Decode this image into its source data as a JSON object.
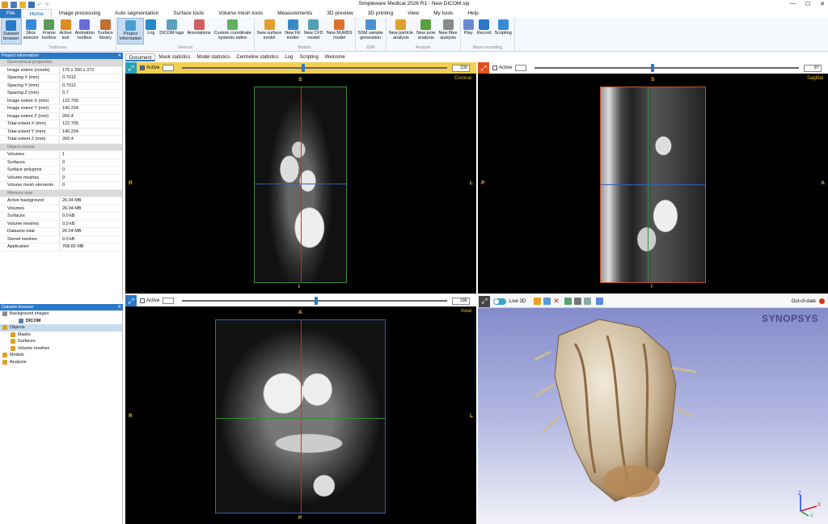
{
  "window": {
    "title": "Simpleware Medical 2026 R1 - New DICOM.sip",
    "minimize": "—",
    "maximize": "☐",
    "close": "✕"
  },
  "menu": [
    "File",
    "Home",
    "Image processing",
    "Auto segmentation",
    "Surface tools",
    "Volume mesh tools",
    "Measurements",
    "3D preview",
    "3D printing",
    "View",
    "My tools",
    "Help"
  ],
  "ribbon": {
    "groups": [
      {
        "label": "Toolboxes",
        "buttons": [
          [
            "Dataset",
            "browser"
          ],
          [
            "Slice",
            "selector"
          ],
          [
            "Frame",
            "toolbox"
          ],
          [
            "Active",
            "tool"
          ],
          [
            "Animation",
            "toolbox"
          ],
          [
            "Surface",
            "library"
          ]
        ]
      },
      {
        "label": "General",
        "buttons": [
          [
            "Project",
            "information"
          ],
          [
            "Log",
            ""
          ],
          [
            "DICOM tags",
            ""
          ],
          [
            "Annotations",
            ""
          ],
          [
            "Custom coordinate",
            "systems editor"
          ]
        ]
      },
      {
        "label": "Models",
        "buttons": [
          [
            "New surface",
            "model"
          ],
          [
            "New FE",
            "model"
          ],
          [
            "New CFD",
            "model"
          ],
          [
            "New NURBS",
            "model"
          ]
        ]
      },
      {
        "label": "SSM",
        "buttons": [
          [
            "SSM sample",
            "generation"
          ]
        ]
      },
      {
        "label": "Analysis",
        "buttons": [
          [
            "New particle",
            "analysis"
          ],
          [
            "New pore",
            "analysis"
          ],
          [
            "New fibre",
            "analysis"
          ]
        ]
      },
      {
        "label": "Macro recording",
        "buttons": [
          [
            "Play",
            ""
          ],
          [
            "Record",
            ""
          ],
          [
            "Scripting",
            ""
          ]
        ]
      }
    ]
  },
  "project_info": {
    "title": "Project information",
    "close": "✕",
    "rows": [
      {
        "k": "Geometrical properties",
        "v": "",
        "section": true
      },
      {
        "k": "Image extent (voxels)",
        "v": "175 x 200 x 372"
      },
      {
        "k": "Spacing X (mm)",
        "v": "0.7012"
      },
      {
        "k": "Spacing Y (mm)",
        "v": "0.7012"
      },
      {
        "k": "Spacing Z (mm)",
        "v": "0.7"
      },
      {
        "k": "Image extent X (mm)",
        "v": "122.705"
      },
      {
        "k": "Image extent Y (mm)",
        "v": "140.234"
      },
      {
        "k": "Image extent Z (mm)",
        "v": "260.4"
      },
      {
        "k": "Total extent X (mm)",
        "v": "122.705"
      },
      {
        "k": "Total extent Y (mm)",
        "v": "140.234"
      },
      {
        "k": "Total extent Z (mm)",
        "v": "260.4"
      },
      {
        "k": "Object counts",
        "v": "",
        "section": true
      },
      {
        "k": "Volumes",
        "v": "1"
      },
      {
        "k": "Surfaces",
        "v": "0"
      },
      {
        "k": "Surface polygons",
        "v": "0"
      },
      {
        "k": "Volume meshes",
        "v": "0"
      },
      {
        "k": "Volume mesh elements",
        "v": "0"
      },
      {
        "k": "Memory size",
        "v": "",
        "section": true
      },
      {
        "k": "Active background",
        "v": "26.04 MB"
      },
      {
        "k": "Volumes",
        "v": "26.04 MB"
      },
      {
        "k": "Surfaces",
        "v": "0.0 kB"
      },
      {
        "k": "Volume meshes",
        "v": "0.0 kB"
      },
      {
        "k": "Datasets total",
        "v": "26.04 MB"
      },
      {
        "k": "Stored meshes",
        "v": "0.0 kB"
      },
      {
        "k": "Application",
        "v": "768.82 MB"
      }
    ]
  },
  "dataset_browser": {
    "title": "Dataset browser",
    "close": "✕",
    "nodes": [
      {
        "label": "Background images",
        "level": 0,
        "color": "#8a8a8a"
      },
      {
        "label": "DICOM",
        "level": 2,
        "color": "#5a7fb0",
        "bold": true
      },
      {
        "label": "Objects",
        "level": 0,
        "color": "#e0a020",
        "selected": true
      },
      {
        "label": "Masks",
        "level": 1,
        "color": "#e0a020"
      },
      {
        "label": "Surfaces",
        "level": 1,
        "color": "#e0a020"
      },
      {
        "label": "Volume meshes",
        "level": 1,
        "color": "#e0a020"
      },
      {
        "label": "Models",
        "level": 0,
        "color": "#e0a020"
      },
      {
        "label": "Analysis",
        "level": 0,
        "color": "#e0a020"
      }
    ]
  },
  "doc_tabs": [
    "Document",
    "Mask statistics",
    "Model statistics",
    "Centreline statistics",
    "Log",
    "Scripting",
    "Welcome"
  ],
  "views": {
    "coronal": {
      "name": "Coronal",
      "active_label": "Active",
      "active": true,
      "value": "100",
      "top": "S",
      "bottom": "I",
      "left": "R",
      "right": "L",
      "slider": 0.45
    },
    "sagittal": {
      "name": "Sagittal",
      "active_label": "Active",
      "active": false,
      "value": "87",
      "top": "S",
      "bottom": "I",
      "left": "P",
      "right": "A",
      "slider": 0.44
    },
    "axial": {
      "name": "Axial",
      "active_label": "Active",
      "active": false,
      "value": "186",
      "top": "A",
      "bottom": "P",
      "left": "R",
      "right": "L",
      "slider": 0.5
    }
  },
  "view3d": {
    "live_label": "Live 3D",
    "status": "Out-of-date",
    "brand": "SYNOPSYS",
    "axes": {
      "x": "X",
      "y": "Y",
      "z": "Z"
    }
  }
}
